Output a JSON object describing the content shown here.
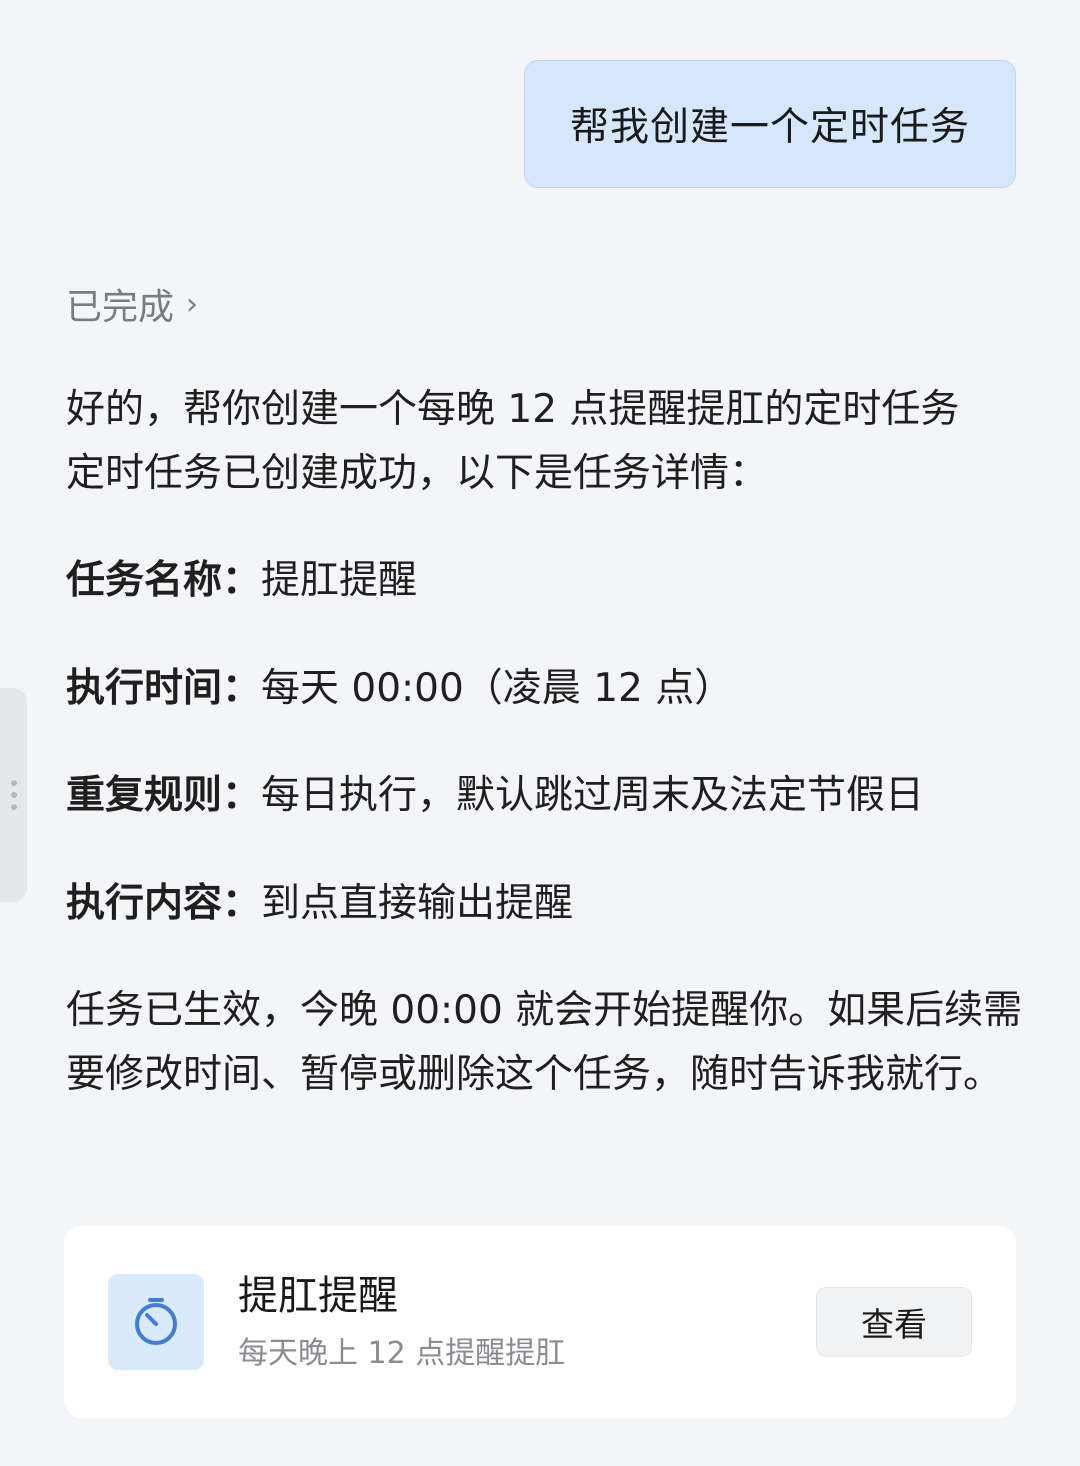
{
  "user_message": "帮我创建一个定时任务",
  "status": {
    "label": "已完成",
    "chevron": "›"
  },
  "reply": {
    "intro_line1": "好的，帮你创建一个每晚 12 点提醒提肛的定时任务",
    "intro_line2": "定时任务已创建成功，以下是任务详情：",
    "details": [
      {
        "key": "任务名称：",
        "value": "提肛提醒"
      },
      {
        "key": "执行时间：",
        "value": "每天 00:00（凌晨 12 点）"
      },
      {
        "key": "重复规则：",
        "value": "每日执行，默认跳过周末及法定节假日"
      },
      {
        "key": "执行内容：",
        "value": "到点直接输出提醒"
      }
    ],
    "closing": "任务已生效，今晚 00:00 就会开始提醒你。如果后续需要修改时间、暂停或删除这个任务，随时告诉我就行。"
  },
  "task_card": {
    "icon": "timer-icon",
    "title": "提肛提醒",
    "subtitle": "每天晚上 12 点提醒提肛",
    "view_label": "查看",
    "icon_color": "#3f7fd9"
  }
}
